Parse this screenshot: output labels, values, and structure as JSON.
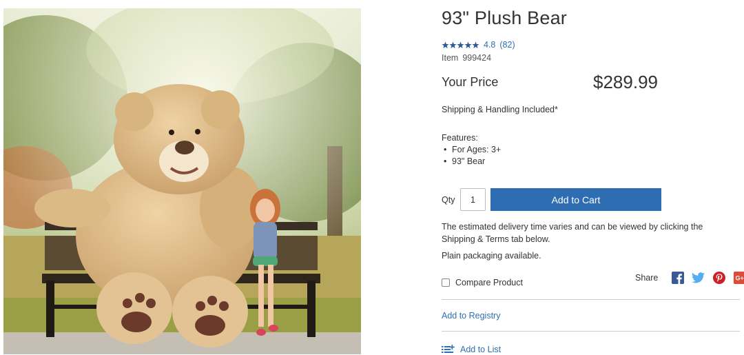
{
  "product": {
    "title": "93\" Plush Bear",
    "rating": "4.8",
    "review_count": "(82)",
    "stars_filled": 5,
    "item_label": "Item",
    "item_number": "999424",
    "price_label": "Your Price",
    "price": "$289.99",
    "shipping_note": "Shipping & Handling Included*",
    "features_label": "Features:",
    "features": [
      "For Ages: 3+",
      "93\" Bear"
    ]
  },
  "purchase": {
    "qty_label": "Qty",
    "qty_value": "1",
    "add_to_cart_label": "Add to Cart"
  },
  "info": {
    "delivery_text": "The estimated delivery time varies and can be viewed by clicking the Shipping & Terms tab below.",
    "packaging_text": "Plain packaging available."
  },
  "actions": {
    "compare_label": "Compare Product",
    "share_label": "Share",
    "registry_label": "Add to Registry",
    "list_label": "Add to List"
  },
  "social_icons": [
    "facebook-icon",
    "twitter-icon",
    "pinterest-icon",
    "google-plus-icon"
  ],
  "colors": {
    "accent": "#2f6db2",
    "link": "#2d6fb1",
    "facebook": "#3b5998",
    "twitter": "#55acee",
    "pinterest": "#cb2027",
    "google_plus": "#dd4b39"
  }
}
